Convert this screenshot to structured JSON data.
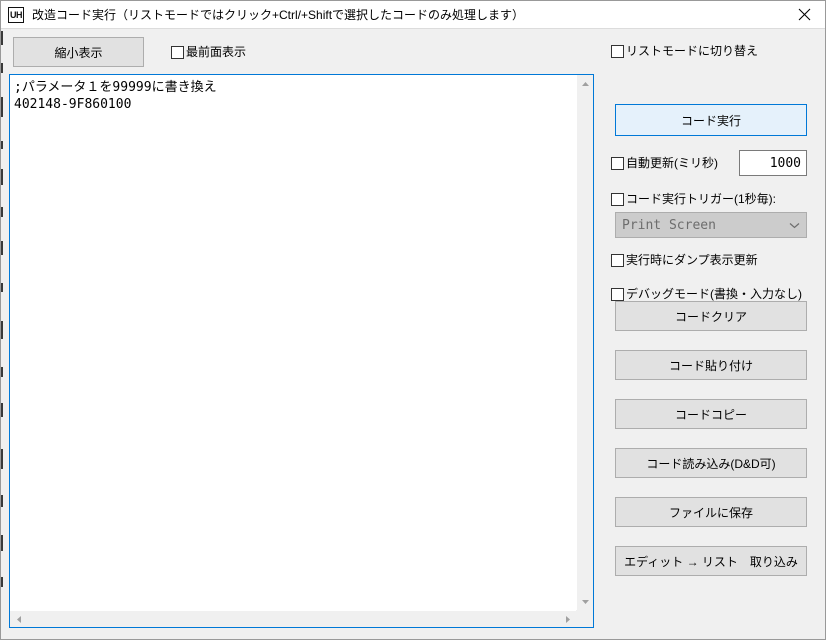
{
  "window": {
    "title": "改造コード実行（リストモードではクリック+Ctrl/+Shiftで選択したコードのみ処理します）",
    "icon_label": "UH",
    "close_label": "×"
  },
  "toolbar": {
    "shrink_button": "縮小表示",
    "topmost_checkbox": "最前面表示"
  },
  "editor": {
    "line1": ";パラメータ１を99999に書き換え",
    "line2": "402148-9F860100",
    "content": ";パラメータ１を99999に書き換え\n402148-9F860100"
  },
  "panel": {
    "listmode_checkbox": "リストモードに切り替え",
    "run_button": "コード実行",
    "autoupdate_checkbox": "自動更新(ミリ秒)",
    "autoupdate_value": "1000",
    "trigger_checkbox": "コード実行トリガー(1秒毎):",
    "trigger_selected": "Print Screen",
    "dump_checkbox": "実行時にダンプ表示更新",
    "debug_checkbox": "デバッグモード(書換・入力なし)",
    "btn_clear": "コードクリア",
    "btn_paste": "コード貼り付け",
    "btn_copy": "コードコピー",
    "btn_load": "コード読み込み(D&D可)",
    "btn_save": "ファイルに保存",
    "btn_import": "エディット → リスト　取り込み"
  },
  "colors": {
    "accent": "#0078d7",
    "accent_fill": "#e5f1fb",
    "window_bg": "#f0f0f0",
    "button_bg": "#e1e1e1",
    "disabled_bg": "#cccccc"
  }
}
